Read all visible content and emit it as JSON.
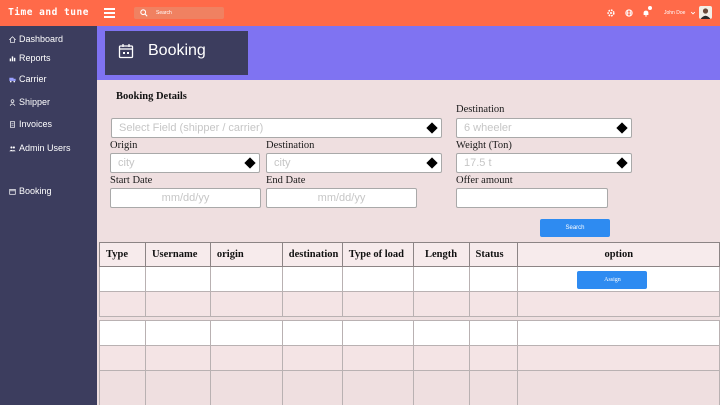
{
  "app": {
    "brand": "Time and tune"
  },
  "topbar": {
    "search_placeholder": "Search",
    "user_name": "John Doe",
    "icons": [
      "menu-icon",
      "search-icon",
      "settings-icon",
      "globe-icon",
      "bell-icon",
      "chevron-down-icon"
    ]
  },
  "sidebar": {
    "items": [
      {
        "label": "Dashboard",
        "icon": "home-icon"
      },
      {
        "label": "Reports",
        "icon": "bar-chart-icon"
      },
      {
        "label": "Carrier",
        "icon": "truck-icon"
      },
      {
        "label": "Shipper",
        "icon": "user-icon"
      },
      {
        "label": "Invoices",
        "icon": "document-icon"
      },
      {
        "label": "Admin Users",
        "icon": "users-icon"
      },
      {
        "label": "Booking",
        "icon": "calendar-icon"
      }
    ]
  },
  "header": {
    "title": "Booking",
    "icon": "calendar-icon"
  },
  "form": {
    "section_title": "Booking Details",
    "select_field": {
      "placeholder": "Select Field (shipper / carrier)"
    },
    "origin": {
      "label": "Origin",
      "placeholder": "city"
    },
    "destination": {
      "label": "Destination",
      "placeholder": "city"
    },
    "start_date": {
      "label": "Start Date",
      "placeholder": "mm/dd/yy"
    },
    "end_date": {
      "label": "End Date",
      "placeholder": "mm/dd/yy"
    },
    "vehicle": {
      "label": "Destination",
      "placeholder": "6 wheeler"
    },
    "weight": {
      "label": "Weight (Ton)",
      "placeholder": "17.5 t"
    },
    "offer": {
      "label": "Offer amount",
      "value": ""
    },
    "search_button": "Search"
  },
  "table": {
    "columns": [
      "Type",
      "Username",
      "origin",
      "destination",
      "Type of load",
      "Length",
      "Status",
      "option"
    ],
    "assign_button": "Assign",
    "rows": [
      [
        "",
        "",
        "",
        "",
        "",
        "",
        ""
      ],
      [
        "",
        "",
        "",
        "",
        "",
        "",
        ""
      ],
      [
        "",
        "",
        "",
        "",
        "",
        "",
        ""
      ],
      [
        "",
        "",
        "",
        "",
        "",
        "",
        ""
      ]
    ]
  },
  "colors": {
    "topbar": "#ff6a49",
    "sidebar": "#3c3d5e",
    "header_band": "#7f73f2",
    "content_bg": "#efdfe0",
    "button": "#2e8bf1"
  }
}
